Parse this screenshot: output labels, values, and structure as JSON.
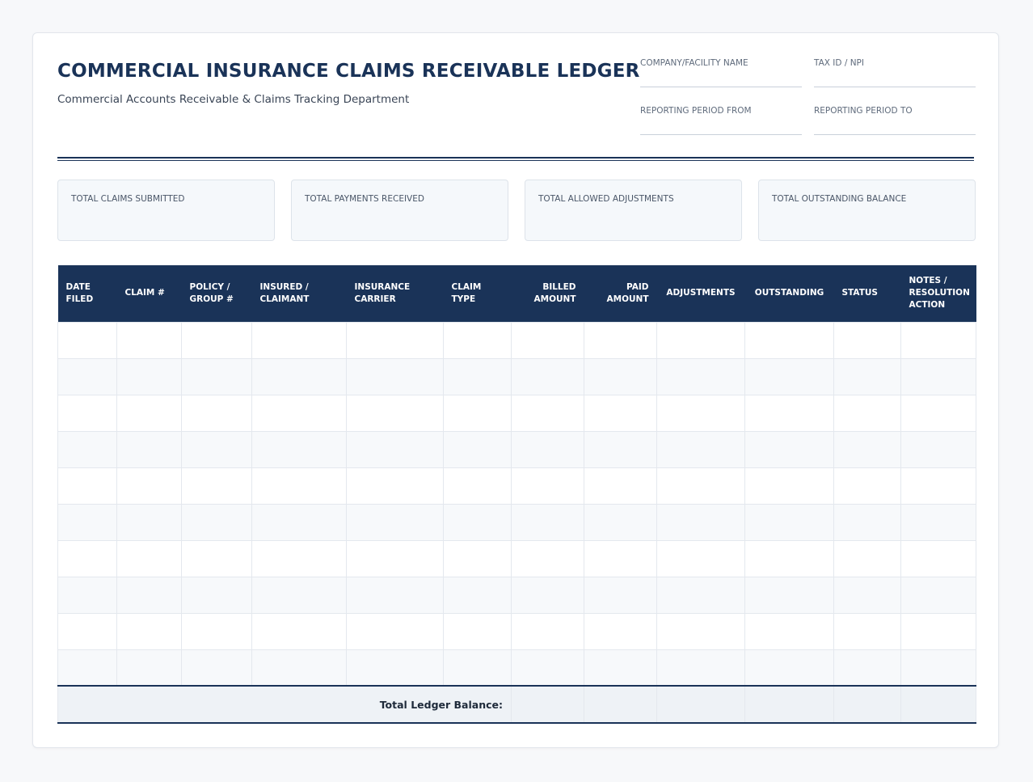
{
  "header": {
    "title": "COMMERCIAL INSURANCE CLAIMS RECEIVABLE LEDGER",
    "subtitle": "Commercial Accounts Receivable & Claims Tracking Department"
  },
  "fields": {
    "company": {
      "label": "COMPANY/FACILITY NAME",
      "value": ""
    },
    "tax_id": {
      "label": "TAX ID / NPI",
      "value": ""
    },
    "period_from": {
      "label": "REPORTING PERIOD FROM",
      "value": ""
    },
    "period_to": {
      "label": "REPORTING PERIOD TO",
      "value": ""
    }
  },
  "summary": {
    "claims_submitted": {
      "label": "TOTAL CLAIMS SUBMITTED",
      "value": ""
    },
    "payments_received": {
      "label": "TOTAL PAYMENTS RECEIVED",
      "value": ""
    },
    "allowed_adjustments": {
      "label": "TOTAL ALLOWED ADJUSTMENTS",
      "value": ""
    },
    "outstanding_balance": {
      "label": "TOTAL OUTSTANDING BALANCE",
      "value": ""
    }
  },
  "table": {
    "columns": {
      "date_filed": [
        "DATE",
        "FILED"
      ],
      "claim_no": [
        "CLAIM #"
      ],
      "policy": [
        "POLICY /",
        "GROUP #"
      ],
      "insured": [
        "INSURED /",
        "CLAIMANT"
      ],
      "carrier": [
        "INSURANCE",
        "CARRIER"
      ],
      "claim_type": [
        "CLAIM",
        "TYPE"
      ],
      "billed": [
        "BILLED",
        "AMOUNT"
      ],
      "paid": [
        "PAID",
        "AMOUNT"
      ],
      "adjustments": [
        "ADJUSTMENTS"
      ],
      "outstanding": [
        "OUTSTANDING"
      ],
      "status": [
        "STATUS"
      ],
      "notes": [
        "NOTES /",
        "RESOLUTION",
        "ACTION"
      ]
    },
    "rows": [
      [
        "",
        "",
        "",
        "",
        "",
        "",
        "",
        "",
        "",
        "",
        "",
        ""
      ],
      [
        "",
        "",
        "",
        "",
        "",
        "",
        "",
        "",
        "",
        "",
        "",
        ""
      ],
      [
        "",
        "",
        "",
        "",
        "",
        "",
        "",
        "",
        "",
        "",
        "",
        ""
      ],
      [
        "",
        "",
        "",
        "",
        "",
        "",
        "",
        "",
        "",
        "",
        "",
        ""
      ],
      [
        "",
        "",
        "",
        "",
        "",
        "",
        "",
        "",
        "",
        "",
        "",
        ""
      ],
      [
        "",
        "",
        "",
        "",
        "",
        "",
        "",
        "",
        "",
        "",
        "",
        ""
      ],
      [
        "",
        "",
        "",
        "",
        "",
        "",
        "",
        "",
        "",
        "",
        "",
        ""
      ],
      [
        "",
        "",
        "",
        "",
        "",
        "",
        "",
        "",
        "",
        "",
        "",
        ""
      ],
      [
        "",
        "",
        "",
        "",
        "",
        "",
        "",
        "",
        "",
        "",
        "",
        ""
      ],
      [
        "",
        "",
        "",
        "",
        "",
        "",
        "",
        "",
        "",
        "",
        "",
        ""
      ]
    ],
    "total_label": "Total Ledger Balance:",
    "totals": [
      "",
      "",
      "",
      "",
      ""
    ]
  },
  "colors": {
    "navy": "#1a3358",
    "row_alt": "#f7f9fb",
    "summary_bg": "#f5f8fb"
  }
}
